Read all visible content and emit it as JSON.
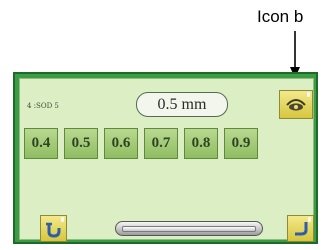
{
  "callout": {
    "label": "Icon b"
  },
  "screen": {
    "code_text": "4 :SOD 5",
    "current_value": "0.5 mm",
    "options": [
      "0.4",
      "0.5",
      "0.6",
      "0.7",
      "0.8",
      "0.9"
    ]
  },
  "icons": {
    "eye": "eye-icon",
    "mode": "presser-foot-icon",
    "next": "return-arrow-icon"
  },
  "colors": {
    "panel": "#3c9c45",
    "screen": "#dcefc4",
    "option_key": "#a6ca78",
    "yellow_key": "#e6da5e"
  }
}
